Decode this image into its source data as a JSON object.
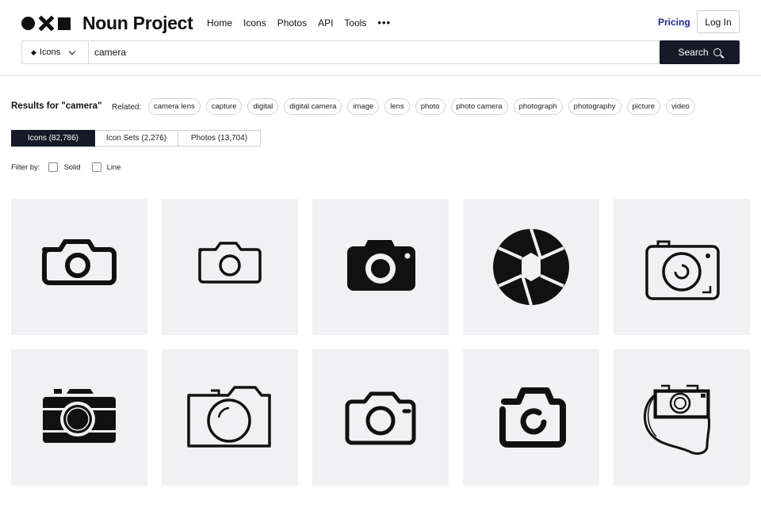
{
  "brand": {
    "name": "Noun Project"
  },
  "nav": {
    "items": [
      "Home",
      "Icons",
      "Photos",
      "API",
      "Tools"
    ],
    "more": "•••"
  },
  "header": {
    "pricing": "Pricing",
    "login": "Log In"
  },
  "search": {
    "type_label": "Icons",
    "query": "camera",
    "button": "Search"
  },
  "results": {
    "title": "Results for \"camera\"",
    "related_label": "Related:",
    "related": [
      "camera lens",
      "capture",
      "digital",
      "digital camera",
      "image",
      "lens",
      "photo",
      "photo camera",
      "photograph",
      "photography",
      "picture",
      "video"
    ]
  },
  "tabs": [
    {
      "label": "Icons (82,786)",
      "active": true
    },
    {
      "label": "Icon Sets (2,276)",
      "active": false
    },
    {
      "label": "Photos (13,704)",
      "active": false
    }
  ],
  "filter": {
    "label": "Filter by:",
    "options": [
      "Solid",
      "Line"
    ]
  },
  "icons": [
    "camera-outline-bold-icon",
    "camera-outline-thin-icon",
    "camera-solid-icon",
    "aperture-shutter-icon",
    "camera-sketch-lens-icon",
    "camera-solid-vintage-icon",
    "camera-outline-wide-icon",
    "camera-outline-rounded-icon",
    "camera-brush-icon",
    "camera-hand-drawn-strap-icon"
  ],
  "colors": {
    "dark": "#161a26",
    "pricing": "#1b2a8a",
    "tile_bg": "#f1f1f3"
  }
}
